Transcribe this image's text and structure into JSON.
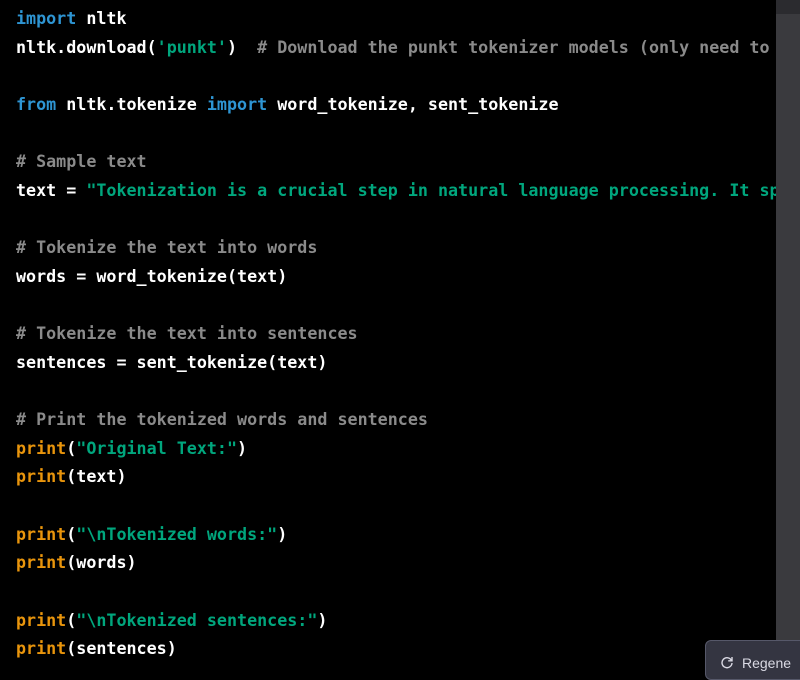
{
  "colors": {
    "background": "#000000",
    "keyword": "#2e95d3",
    "builtin": "#e9950c",
    "string": "#00a67d",
    "comment": "#8a8a8a",
    "text": "#ffffff"
  },
  "code": {
    "line1": {
      "kw": "import",
      "rest": " nltk"
    },
    "line2": {
      "a": "nltk.download(",
      "str": "'punkt'",
      "b": ")  ",
      "comment": "# Download the punkt tokenizer models (only need to"
    },
    "line3": {
      "kw1": "from",
      "a": " nltk.tokenize ",
      "kw2": "import",
      "b": " word_tokenize, sent_tokenize"
    },
    "line4": {
      "comment": "# Sample text"
    },
    "line5": {
      "a": "text = ",
      "str": "\"Tokenization is a crucial step in natural language processing. It sp"
    },
    "line6": {
      "comment": "# Tokenize the text into words"
    },
    "line7": {
      "a": "words = word_tokenize(text)"
    },
    "line8": {
      "comment": "# Tokenize the text into sentences"
    },
    "line9": {
      "a": "sentences = sent_tokenize(text)"
    },
    "line10": {
      "comment": "# Print the tokenized words and sentences"
    },
    "line11": {
      "fn": "print",
      "a": "(",
      "str": "\"Original Text:\"",
      "b": ")"
    },
    "line12": {
      "fn": "print",
      "a": "(text)"
    },
    "line13": {
      "fn": "print",
      "a": "(",
      "str": "\"\\nTokenized words:\"",
      "b": ")"
    },
    "line14": {
      "fn": "print",
      "a": "(words)"
    },
    "line15": {
      "fn": "print",
      "a": "(",
      "str": "\"\\nTokenized sentences:\"",
      "b": ")"
    },
    "line16": {
      "fn": "print",
      "a": "(sentences)"
    }
  },
  "regenerate_button": {
    "label": "Regene",
    "icon": "refresh-icon"
  }
}
